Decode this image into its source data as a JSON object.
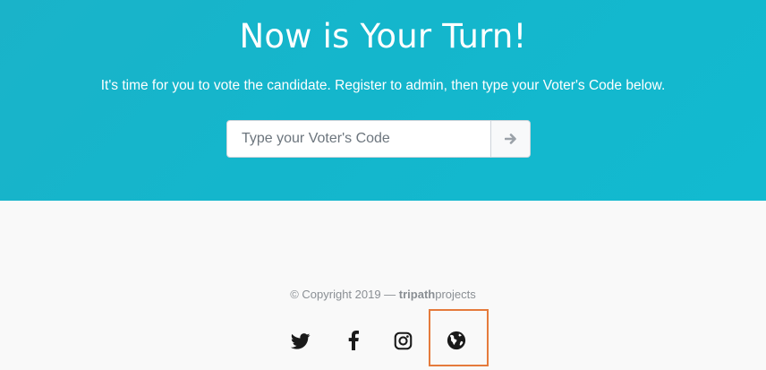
{
  "hero": {
    "title": "Now is Your Turn!",
    "subtitle": "It's time for you to vote the candidate. Register to admin, then type your Voter's Code below.",
    "input_placeholder": "Type your Voter's Code",
    "submit_icon": "arrow-right-icon"
  },
  "footer": {
    "copyright_prefix": "© Copyright 2019 — ",
    "brand_bold": "tripath",
    "brand_rest": "projects",
    "socials": [
      {
        "name": "twitter-icon"
      },
      {
        "name": "facebook-icon"
      },
      {
        "name": "instagram-icon"
      },
      {
        "name": "globe-icon"
      }
    ]
  },
  "colors": {
    "hero_bg": "#14b6cc",
    "footer_bg": "#f9f9f9",
    "highlight": "#e57b3c"
  }
}
